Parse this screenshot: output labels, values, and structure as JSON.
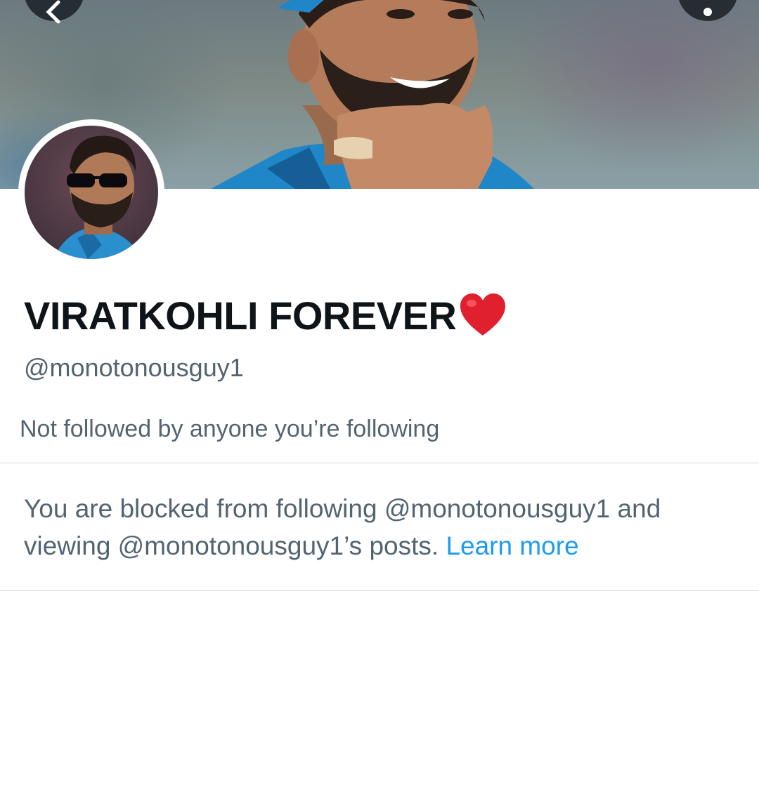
{
  "profile": {
    "display_name": "VIRATKOHLI FOREVER",
    "handle": "@monotonousguy1",
    "followed_by_text": "Not followed by anyone you’re following"
  },
  "block_notice": {
    "text": "You are blocked from following @monotonousguy1 and viewing @monotonousguy1’s posts.",
    "learn_more_label": "Learn more"
  },
  "icons": {
    "back": "arrow-left-icon",
    "more": "more-vertical-icon",
    "verified_emoji": "red-heart-icon"
  },
  "colors": {
    "text_primary": "#0f1419",
    "text_secondary": "#536471",
    "link": "#1d9bf0",
    "divider": "#cfd9de",
    "heart": "#e0202e"
  }
}
